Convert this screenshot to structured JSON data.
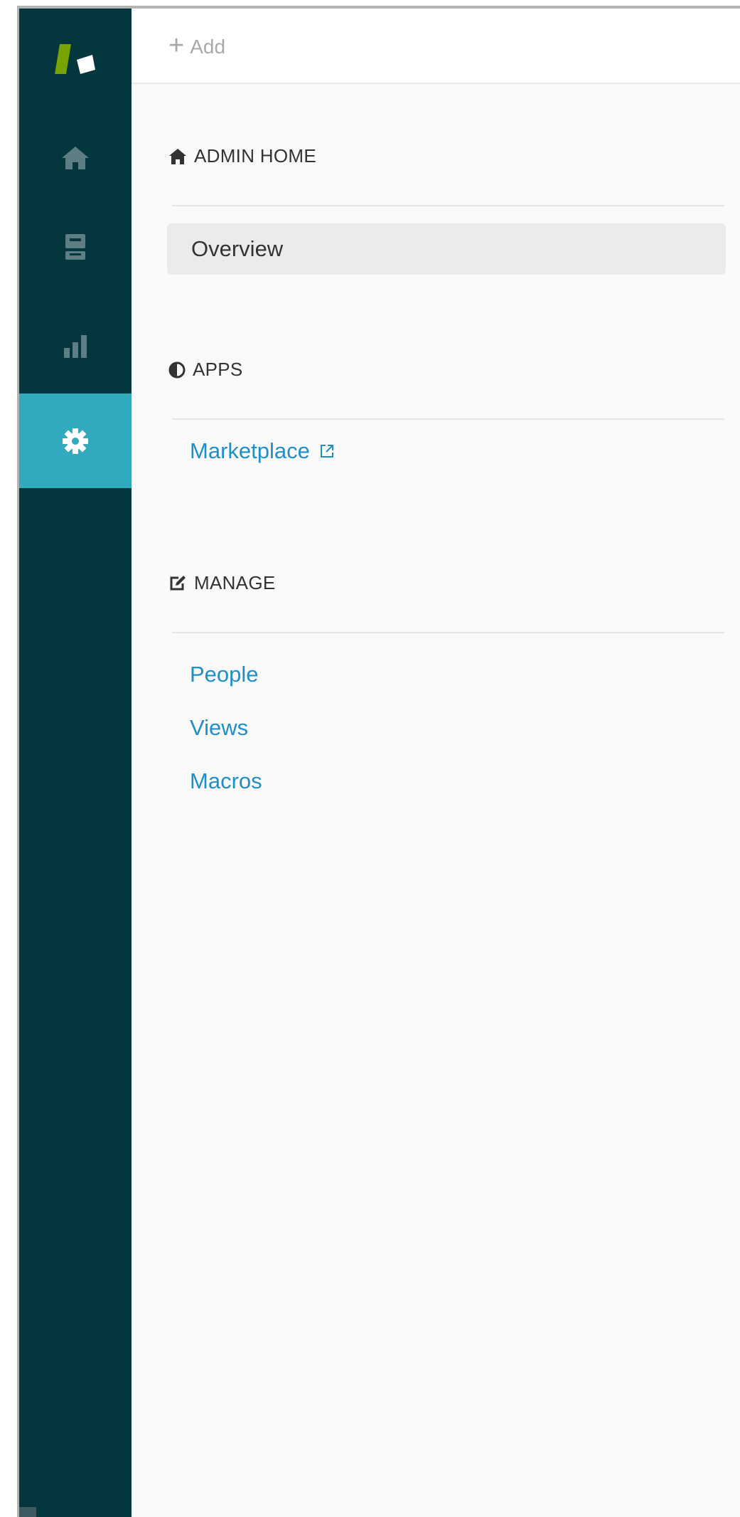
{
  "rail": {
    "items": [
      {
        "name": "logo",
        "icon": "zendesk-logo"
      },
      {
        "name": "home",
        "icon": "home-icon"
      },
      {
        "name": "views",
        "icon": "views-icon"
      },
      {
        "name": "reporting",
        "icon": "bar-chart-icon"
      },
      {
        "name": "admin",
        "icon": "gear-icon",
        "active": true
      }
    ],
    "colors": {
      "background": "#03363d",
      "active": "#30aabc",
      "icon": "#5d7f84",
      "logo_green": "#78a300"
    }
  },
  "topbar": {
    "add_label": "Add",
    "add_icon": "plus-icon"
  },
  "sections": {
    "admin_home": {
      "title": "ADMIN HOME",
      "icon": "home-icon",
      "items": [
        {
          "label": "Overview",
          "selected": true
        }
      ]
    },
    "apps": {
      "title": "APPS",
      "icon": "half-circle-icon",
      "items": [
        {
          "label": "Marketplace",
          "external": true,
          "icon": "external-link-icon"
        }
      ]
    },
    "manage": {
      "title": "MANAGE",
      "icon": "edit-icon",
      "items": [
        {
          "label": "People"
        },
        {
          "label": "Views"
        },
        {
          "label": "Macros"
        }
      ]
    }
  },
  "colors": {
    "link": "#1f8fc9",
    "heading": "#333333",
    "selected_bg": "#ebebeb"
  }
}
